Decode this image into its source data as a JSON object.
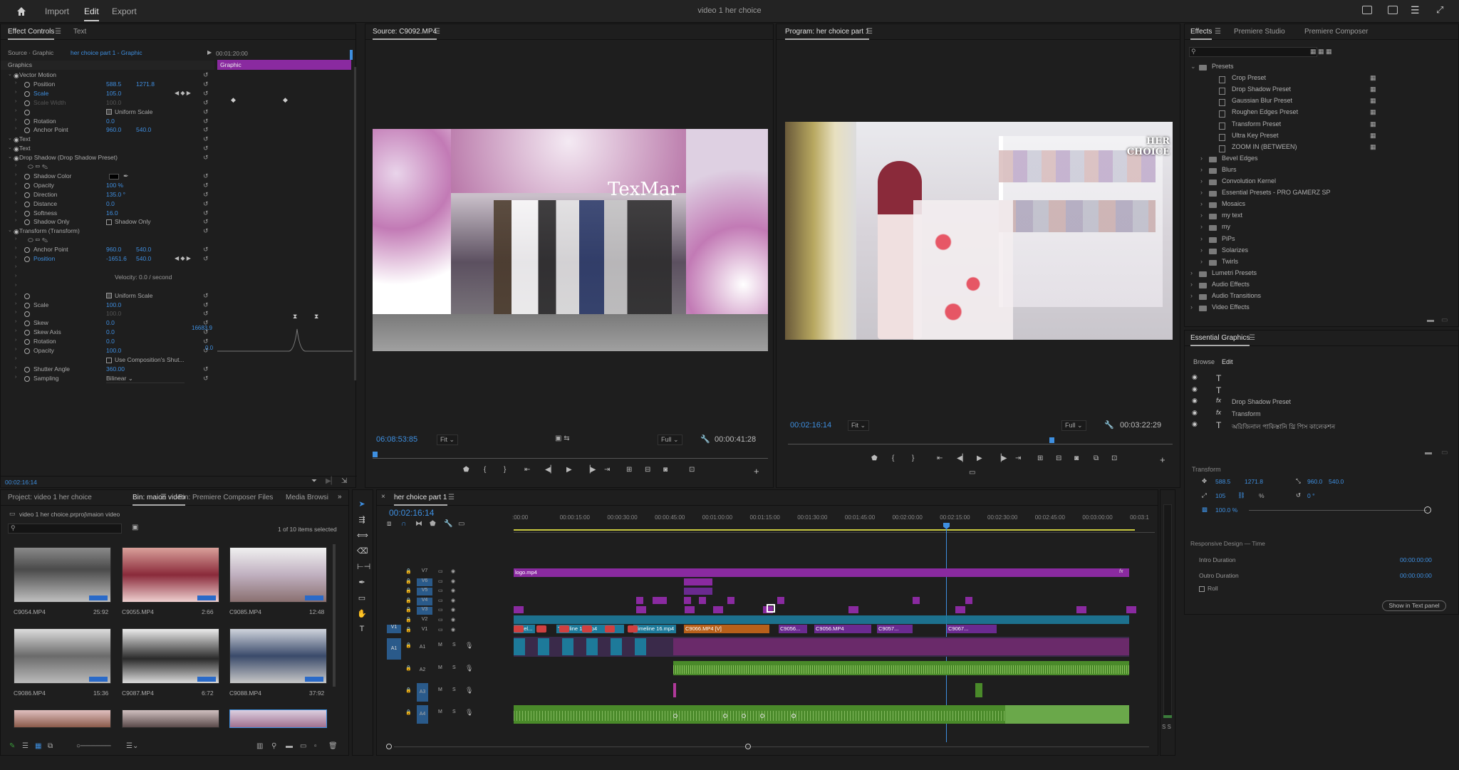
{
  "app": {
    "title": "video 1 her choice",
    "workspaces": [
      "Import",
      "Edit",
      "Export"
    ],
    "active_workspace": "Edit"
  },
  "effect_controls": {
    "tabs": [
      "Effect Controls",
      "Text"
    ],
    "source": "Source · Graphic",
    "clip": "her choice part 1 - Graphic",
    "timecode_start": "00:01:20:00",
    "graphic_bar": "Graphic",
    "section": "Graphics",
    "rows": [
      {
        "label": "Vector Motion",
        "indent": 1,
        "eye": true
      },
      {
        "label": "Position",
        "indent": 2,
        "v1": "588.5",
        "v2": "1271.8"
      },
      {
        "label": "Scale",
        "indent": 2,
        "v1": "105.0",
        "blue_label": true
      },
      {
        "label": "Scale Width",
        "indent": 2,
        "v1": "100.0",
        "dim": true
      },
      {
        "label": "Uniform Scale",
        "indent": 2,
        "check": true
      },
      {
        "label": "Rotation",
        "indent": 2,
        "v1": "0.0"
      },
      {
        "label": "Anchor Point",
        "indent": 2,
        "v1": "960.0",
        "v2": "540.0"
      },
      {
        "label": "Text",
        "indent": 1,
        "eye": true
      },
      {
        "label": "Text",
        "indent": 1,
        "eye": true
      },
      {
        "label": "Drop Shadow (Drop Shadow Preset)",
        "indent": 1,
        "eye": true
      },
      {
        "label": "",
        "indent": 2,
        "shapes": true
      },
      {
        "label": "Shadow Color",
        "indent": 2,
        "swatch": true
      },
      {
        "label": "Opacity",
        "indent": 2,
        "v1": "100 %"
      },
      {
        "label": "Direction",
        "indent": 2,
        "v1": "135.0 °"
      },
      {
        "label": "Distance",
        "indent": 2,
        "v1": "0.0"
      },
      {
        "label": "Softness",
        "indent": 2,
        "v1": "16.0"
      },
      {
        "label": "Shadow Only",
        "indent": 2,
        "checklabel": "Shadow Only"
      },
      {
        "label": "Transform (Transform)",
        "indent": 1,
        "eye": true
      },
      {
        "label": "",
        "indent": 2,
        "shapes": true
      },
      {
        "label": "Anchor Point",
        "indent": 2,
        "v1": "960.0",
        "v2": "540.0"
      },
      {
        "label": "Position",
        "indent": 2,
        "v1": "-1651.6",
        "v2": "540.0",
        "blue_label": true
      },
      {
        "label": "",
        "indent": 2,
        "v1": ""
      },
      {
        "label": "",
        "indent": 2,
        "velocity": "Velocity: 0.0 / second"
      },
      {
        "label": "",
        "indent": 2,
        "v1": ""
      },
      {
        "label": "Uniform Scale",
        "indent": 2,
        "check": true
      },
      {
        "label": "Scale",
        "indent": 2,
        "v1": "100.0"
      },
      {
        "label": "",
        "indent": 2,
        "v1": "100.0",
        "dim": true
      },
      {
        "label": "Skew",
        "indent": 2,
        "v1": "0.0"
      },
      {
        "label": "Skew Axis",
        "indent": 2,
        "v1": "0.0"
      },
      {
        "label": "Rotation",
        "indent": 2,
        "v1": "0.0"
      },
      {
        "label": "Opacity",
        "indent": 2,
        "v1": "100.0"
      },
      {
        "label": "",
        "indent": 2,
        "checklabel": "Use Composition's Shut..."
      },
      {
        "label": "Shutter Angle",
        "indent": 2,
        "v1": "360.00"
      },
      {
        "label": "Sampling",
        "indent": 2,
        "select": "Bilinear"
      }
    ],
    "graph_hi": "16683.9",
    "graph_lo": "0.0",
    "footer_tc": "00:02:16:14"
  },
  "source_monitor": {
    "title": "Source: C9092.MP4",
    "tc_left": "06:08:53:85",
    "fit": "Fit",
    "quality": "Full",
    "tc_right": "00:00:41:28"
  },
  "program_monitor": {
    "title": "Program: her choice part 1",
    "tc_left": "00:02:16:14",
    "fit": "Fit",
    "quality": "Full",
    "tc_right": "00:03:22:29",
    "watermark": "HER CHOICE"
  },
  "effects": {
    "tabs": [
      "Effects",
      "Premiere Studio",
      "Premiere Composer"
    ],
    "items": [
      {
        "label": "Presets",
        "type": "folder",
        "indent": 0,
        "open": true
      },
      {
        "label": "Crop Preset",
        "type": "preset",
        "indent": 2
      },
      {
        "label": "Drop Shadow Preset",
        "type": "preset",
        "indent": 2
      },
      {
        "label": "Gaussian Blur Preset",
        "type": "preset",
        "indent": 2
      },
      {
        "label": "Roughen Edges Preset",
        "type": "preset",
        "indent": 2
      },
      {
        "label": "Transform Preset",
        "type": "preset",
        "indent": 2
      },
      {
        "label": "Ultra Key Preset",
        "type": "preset",
        "indent": 2
      },
      {
        "label": "ZOOM IN (BETWEEN)",
        "type": "preset",
        "indent": 2
      },
      {
        "label": "Bevel Edges",
        "type": "folder",
        "indent": 1
      },
      {
        "label": "Blurs",
        "type": "folder",
        "indent": 1
      },
      {
        "label": "Convolution Kernel",
        "type": "folder",
        "indent": 1
      },
      {
        "label": "Essential Presets - PRO GAMERZ SP",
        "type": "folder",
        "indent": 1
      },
      {
        "label": "Mosaics",
        "type": "folder",
        "indent": 1
      },
      {
        "label": "my text",
        "type": "folder",
        "indent": 1
      },
      {
        "label": "my",
        "type": "folder",
        "indent": 1
      },
      {
        "label": "PiPs",
        "type": "folder",
        "indent": 1
      },
      {
        "label": "Solarizes",
        "type": "folder",
        "indent": 1
      },
      {
        "label": "Twirls",
        "type": "folder",
        "indent": 1
      },
      {
        "label": "Lumetri Presets",
        "type": "folder",
        "indent": 0
      },
      {
        "label": "Audio Effects",
        "type": "folder",
        "indent": 0
      },
      {
        "label": "Audio Transitions",
        "type": "folder",
        "indent": 0
      },
      {
        "label": "Video Effects",
        "type": "folder",
        "indent": 0
      }
    ]
  },
  "essential_graphics": {
    "title": "Essential Graphics",
    "tabs": [
      "Browse",
      "Edit"
    ],
    "layers": [
      {
        "icon": "T",
        "label": ""
      },
      {
        "icon": "T",
        "label": ""
      },
      {
        "icon": "fx",
        "label": "Drop Shadow Preset"
      },
      {
        "icon": "fx",
        "label": "Transform"
      },
      {
        "icon": "T",
        "label": "অরিজিনাল পাকিস্তানি থ্রি পিস কালেকশন"
      }
    ],
    "transform_label": "Transform",
    "pos_x": "588.5",
    "pos_y": "1271.8",
    "anchor_x": "960.0",
    "anchor_y": "540.0",
    "scale": "105",
    "rotation": "0 °",
    "opacity": "100.0 %",
    "pct": "%",
    "responsive": "Responsive Design — Time",
    "intro_label": "Intro Duration",
    "intro_val": "00:00:00:00",
    "outro_label": "Outro Duration",
    "outro_val": "00:00:00:00",
    "roll_label": "Roll",
    "show_panel": "Show in Text panel"
  },
  "project": {
    "tabs": [
      "Project: video 1 her choice",
      "Bin: maion video",
      "Bin: Premiere Composer Files",
      "Media Browsi"
    ],
    "path": "video 1 her choice.prproj\\maion video",
    "selected": "1 of 10 items selected",
    "items": [
      {
        "name": "C9054.MP4",
        "dur": "25:92"
      },
      {
        "name": "C9055.MP4",
        "dur": "2:66"
      },
      {
        "name": "C9085.MP4",
        "dur": "12:48"
      },
      {
        "name": "C9086.MP4",
        "dur": "15:36"
      },
      {
        "name": "C9087.MP4",
        "dur": "6:72"
      },
      {
        "name": "C9088.MP4",
        "dur": "37:92"
      }
    ]
  },
  "timeline": {
    "title": "her choice part 1",
    "tc": "00:02:16:14",
    "ruler": [
      ":00:00",
      "00:00:15:00",
      "00:00:30:00",
      "00:00:45:00",
      "00:01:00:00",
      "00:01:15:00",
      "00:01:30:00",
      "00:01:45:00",
      "00:02:00:00",
      "00:02:15:00",
      "00:02:30:00",
      "00:02:45:00",
      "00:03:00:00",
      "00:03:1"
    ],
    "video_tracks": [
      "V7",
      "V6",
      "V5",
      "V4",
      "V3",
      "V2",
      "V1"
    ],
    "audio_tracks": [
      "A1",
      "A2",
      "A3",
      "A4"
    ],
    "track_mute": "M",
    "track_solo": "S",
    "source_v1": "V1",
    "source_a1": "A1",
    "clip_logo": "logo.mp4",
    "v1_clips": [
      "Timel...",
      "Timeline 16.mp4",
      "Timeline 16.mp4",
      "C9066.MP4 [V]",
      "C9056...",
      "C9056.MP4",
      "C9057...",
      "C9067..."
    ],
    "fx": "fx",
    "meter_label": "S S"
  }
}
